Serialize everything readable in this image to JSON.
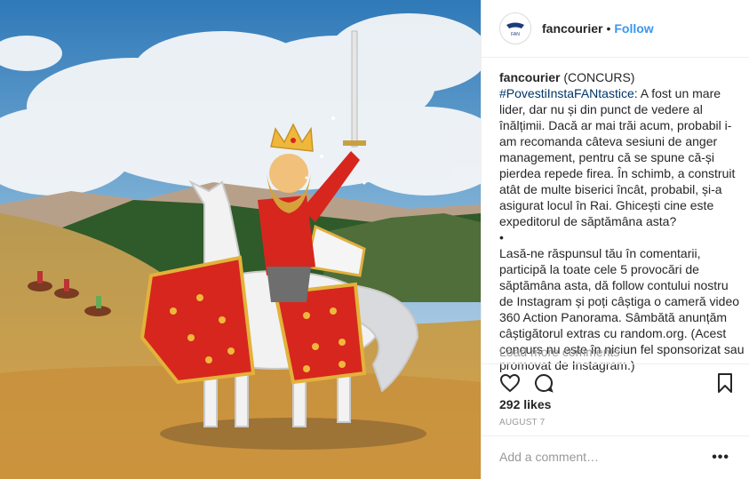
{
  "post": {
    "image_alt": "Illustration of a crowned king on a white horse in front of a mountain landscape"
  },
  "header": {
    "username": "fancourier",
    "separator": "•",
    "follow_label": "Follow",
    "avatar_label": "FAN"
  },
  "caption": {
    "username": "fancourier",
    "tag": "(CONCURS)",
    "hashtag": "#PovestiInstaFANtastice",
    "paragraph1": ": A fost un mare lider, dar nu și din punct de vedere al înălțimii. Dacă ar mai trăi acum, probabil i-am recomanda câteva sesiuni de anger management, pentru că se spune că-și pierdea repede firea. În schimb, a construit atât de multe biserici încât, probabil, și-a asigurat locul în Rai. Ghicești cine este expeditorul de săptămâna asta?",
    "bullet": "•",
    "paragraph2": "Lasă-ne răspunsul tău în comentarii, participă la toate cele 5 provocări de săptămâna asta, dă follow contului nostru de Instagram și poți câștiga o cameră video 360 Action Panorama. Sâmbătă anunțăm câștigătorul extras cu random.org. (Acest concurs nu este în niciun fel sponsorizat sau promovat de Instagram.)"
  },
  "load_more": "Load more comments",
  "likes": "292 likes",
  "date": "AUGUST 7",
  "comment_placeholder": "Add a comment…",
  "more_options": "•••",
  "colors": {
    "accent": "#3897f0",
    "hashtag": "#003569"
  },
  "icons": [
    "heart-icon",
    "comment-icon",
    "bookmark-icon"
  ]
}
